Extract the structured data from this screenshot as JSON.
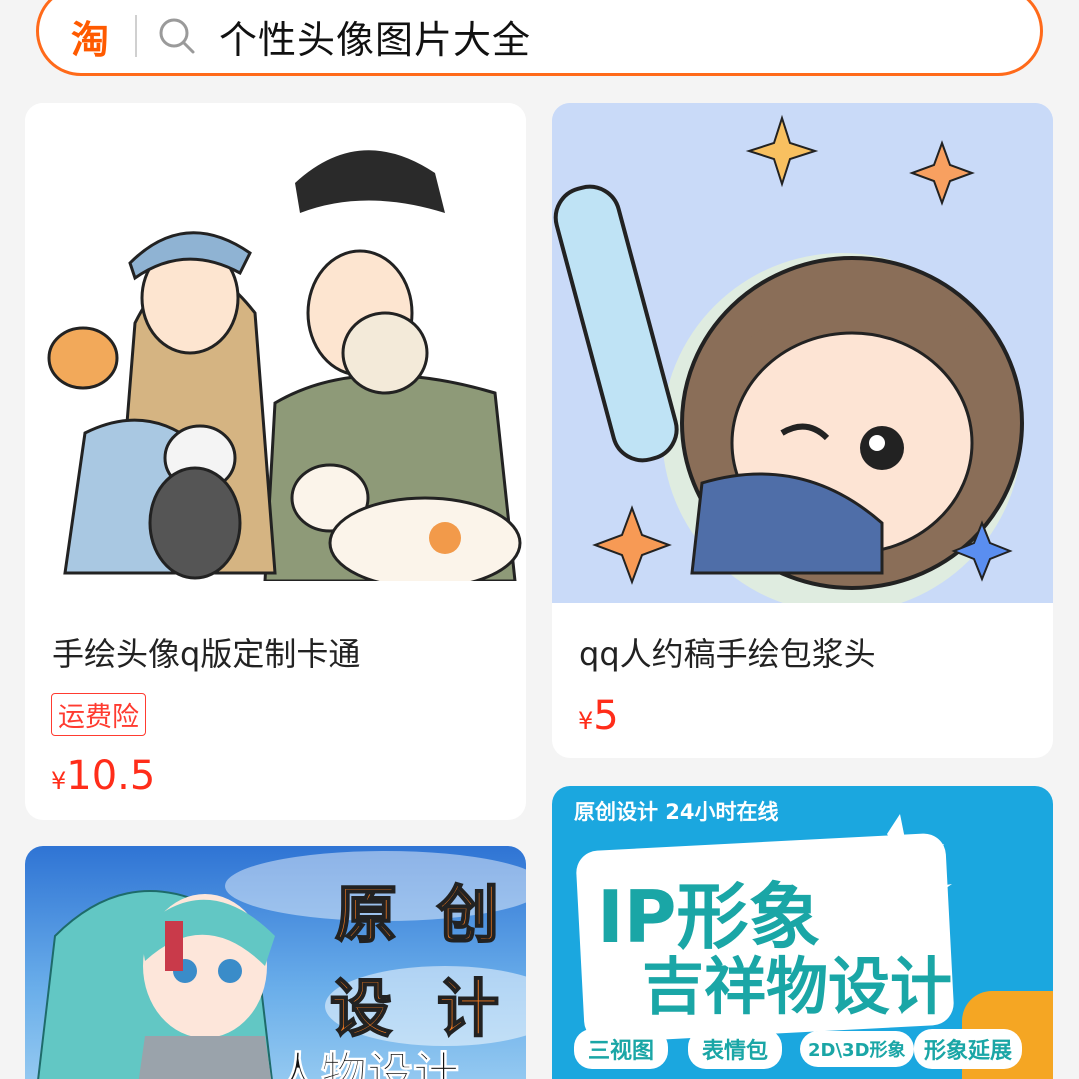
{
  "search": {
    "logo": "淘",
    "query": "个性头像图片大全",
    "icon": "search-icon"
  },
  "products": [
    {
      "title": "手绘头像q版定制卡通",
      "tag": "运费险",
      "currency": "¥",
      "price": "10.5"
    },
    {
      "title": "qq人约稿手绘包浆头",
      "currency": "¥",
      "price": "5"
    },
    {
      "image_text": [
        "原",
        "创",
        "设",
        "计",
        "人物设计"
      ]
    },
    {
      "image_text": {
        "header": "原创设计 24小时在线",
        "line1": "IP形象",
        "line2": "吉祥物设计",
        "chips": [
          "三视图",
          "表情包",
          "2D\\3D形象",
          "形象延展"
        ]
      }
    }
  ],
  "colors": {
    "accent": "#ff6a1a",
    "price": "#ff2d1a",
    "background": "#f4f4f4"
  }
}
